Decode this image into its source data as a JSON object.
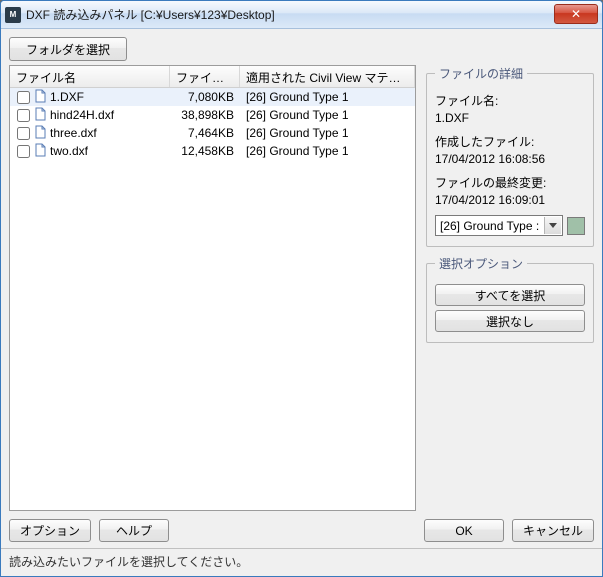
{
  "window": {
    "title": "DXF 読み込みパネル [C:¥Users¥123¥Desktop]"
  },
  "toolbar": {
    "choose_folder": "フォルダを選択"
  },
  "columns": {
    "name": "ファイル名",
    "size": "ファイル ...",
    "material": "適用された Civil View マテリア..."
  },
  "files": [
    {
      "name": "1.DXF",
      "size": "7,080KB",
      "material": "[26] Ground Type 1",
      "selected": true
    },
    {
      "name": "hind24H.dxf",
      "size": "38,898KB",
      "material": "[26] Ground Type 1",
      "selected": false
    },
    {
      "name": "three.dxf",
      "size": "7,464KB",
      "material": "[26] Ground Type 1",
      "selected": false
    },
    {
      "name": "two.dxf",
      "size": "12,458KB",
      "material": "[26] Ground Type 1",
      "selected": false
    }
  ],
  "details": {
    "group_label": "ファイルの詳細",
    "name_label": "ファイル名:",
    "name_value": "1.DXF",
    "created_label": "作成したファイル:",
    "created_value": "17/04/2012 16:08:56",
    "modified_label": "ファイルの最終変更:",
    "modified_value": "17/04/2012 16:09:01",
    "material_selected": "[26] Ground Type :",
    "swatch_color": "#a0c0a8"
  },
  "selection": {
    "group_label": "選択オプション",
    "select_all": "すべてを選択",
    "select_none": "選択なし"
  },
  "buttons": {
    "options": "オプション",
    "help": "ヘルプ",
    "ok": "OK",
    "cancel": "キャンセル"
  },
  "status": "読み込みたいファイルを選択してください。"
}
